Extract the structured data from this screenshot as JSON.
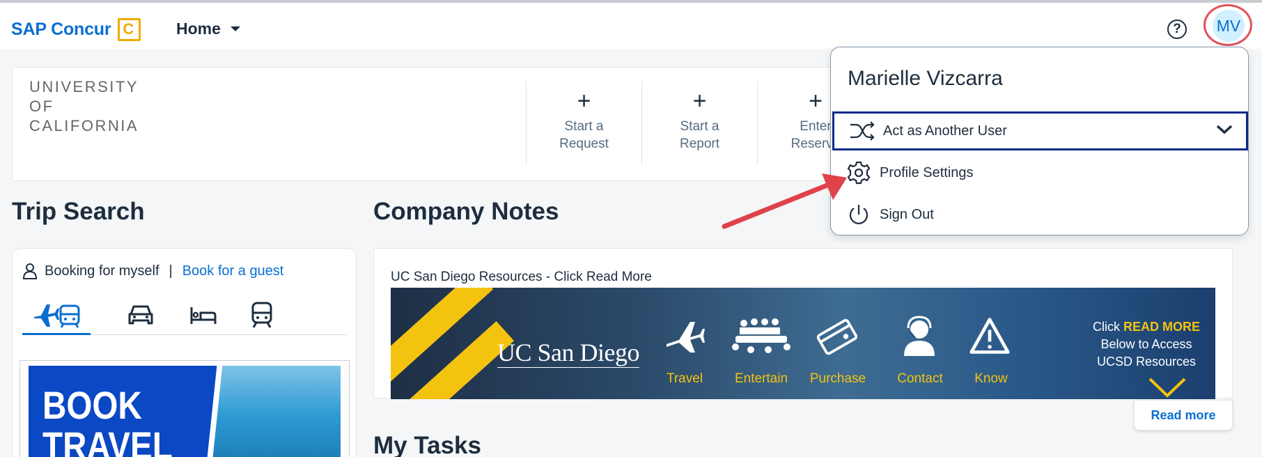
{
  "header": {
    "brand": "SAP Concur",
    "brand_logo_letter": "C",
    "home_label": "Home",
    "help_icon": "question-circle-icon",
    "avatar_initials": "MV"
  },
  "company": {
    "logo_lines": [
      "UNIVERSITY",
      "OF",
      "CALIFORNIA"
    ]
  },
  "quick_actions": [
    {
      "label": "Start a\nRequest",
      "line1": "Start a",
      "line2": "Request"
    },
    {
      "label": "Start a\nReport",
      "line1": "Start a",
      "line2": "Report"
    },
    {
      "label": "Enter\nReservation",
      "line1": "Enter",
      "line2": "Reserva"
    }
  ],
  "trip_search": {
    "title": "Trip Search",
    "booking_self": "Booking for myself",
    "separator": "|",
    "booking_guest": "Book for a guest",
    "modes": [
      "flight-rail-icon",
      "car-icon",
      "hotel-icon",
      "train-icon"
    ],
    "active_mode": "flight-rail-icon",
    "banner_text": [
      "BOOK",
      "TRAVEL"
    ]
  },
  "company_notes": {
    "title": "Company Notes",
    "note_title": "UC San Diego Resources - Click Read More",
    "banner_logo": "UC San Diego",
    "categories": [
      "Travel",
      "Entertain",
      "Purchase",
      "Contact",
      "Know"
    ],
    "click_prefix": "Click ",
    "click_bold": "READ MORE",
    "click_line2": "Below to Access",
    "click_line3": "UCSD Resources",
    "read_more": "Read more"
  },
  "my_tasks": {
    "title": "My Tasks"
  },
  "user_menu": {
    "user_name": "Marielle Vizcarra",
    "items": [
      {
        "label": "Act as Another User",
        "icon": "shuffle-icon"
      },
      {
        "label": "Profile Settings",
        "icon": "gear-icon"
      },
      {
        "label": "Sign Out",
        "icon": "power-icon"
      }
    ]
  },
  "colors": {
    "brand_blue": "#0a6ed1",
    "brand_gold": "#f0ab00",
    "annotation_red": "#e0424a",
    "focus_border": "#0a2a8a"
  }
}
